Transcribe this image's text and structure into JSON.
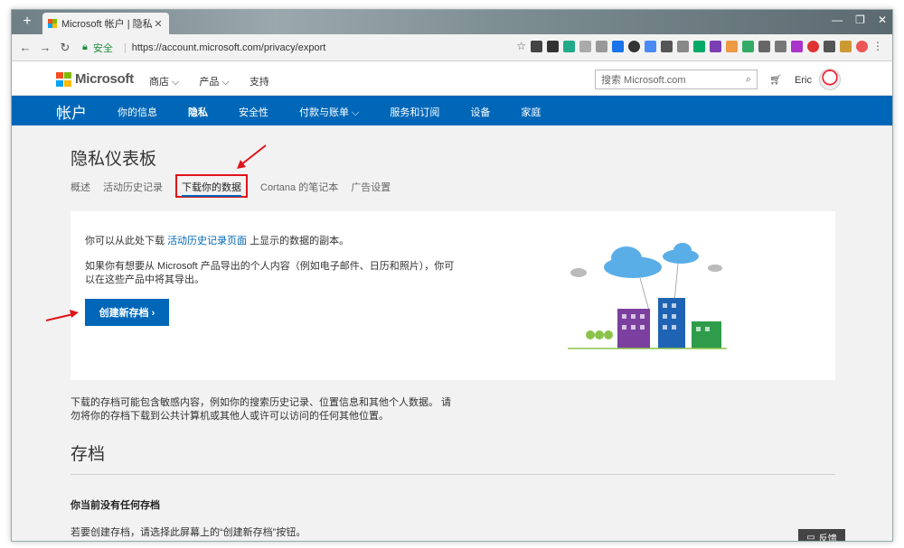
{
  "browser": {
    "new_tab": "+",
    "tab_title": "Microsoft 帐户 | 隐私",
    "tab_close": "✕",
    "window_controls": [
      "—",
      "❐",
      "✕"
    ],
    "secure_label": "安全",
    "url": "https://account.microsoft.com/privacy/export"
  },
  "header": {
    "brand": "Microsoft",
    "nav": [
      "商店 ⌵",
      "产品 ⌵",
      "支持"
    ],
    "search_placeholder": "搜索 Microsoft.com",
    "user_name": "Eric"
  },
  "account_nav": {
    "title": "帐户",
    "items": [
      "你的信息",
      "隐私",
      "安全性",
      "付款与账单 ⌵",
      "服务和订阅",
      "设备",
      "家庭"
    ]
  },
  "page": {
    "title": "隐私仪表板",
    "subnav": [
      "概述",
      "活动历史记录",
      "下载你的数据",
      "Cortana 的笔记本",
      "广告设置"
    ],
    "card": {
      "p1_before": "你可以从此处下载",
      "p1_link": "活动历史记录页面",
      "p1_after": "上显示的数据的副本。",
      "p2": "如果你有想要从 Microsoft 产品导出的个人内容（例如电子邮件、日历和照片），你可以在这些产品中将其导出。",
      "create_button": "创建新存档 ›"
    },
    "note": "下载的存档可能包含敏感内容，例如你的搜索历史记录、位置信息和其他个人数据。 请勿将你的存档下载到公共计算机或其他人或许可以访问的任何其他位置。",
    "archive_title": "存档",
    "empty_title": "你当前没有任何存档",
    "empty_text": "若要创建存档，请选择此屏幕上的“创建新存档”按钮。",
    "feedback": "反馈"
  },
  "colors": {
    "brand_blue": "#0067b8",
    "highlight_red": "#e0131a"
  }
}
